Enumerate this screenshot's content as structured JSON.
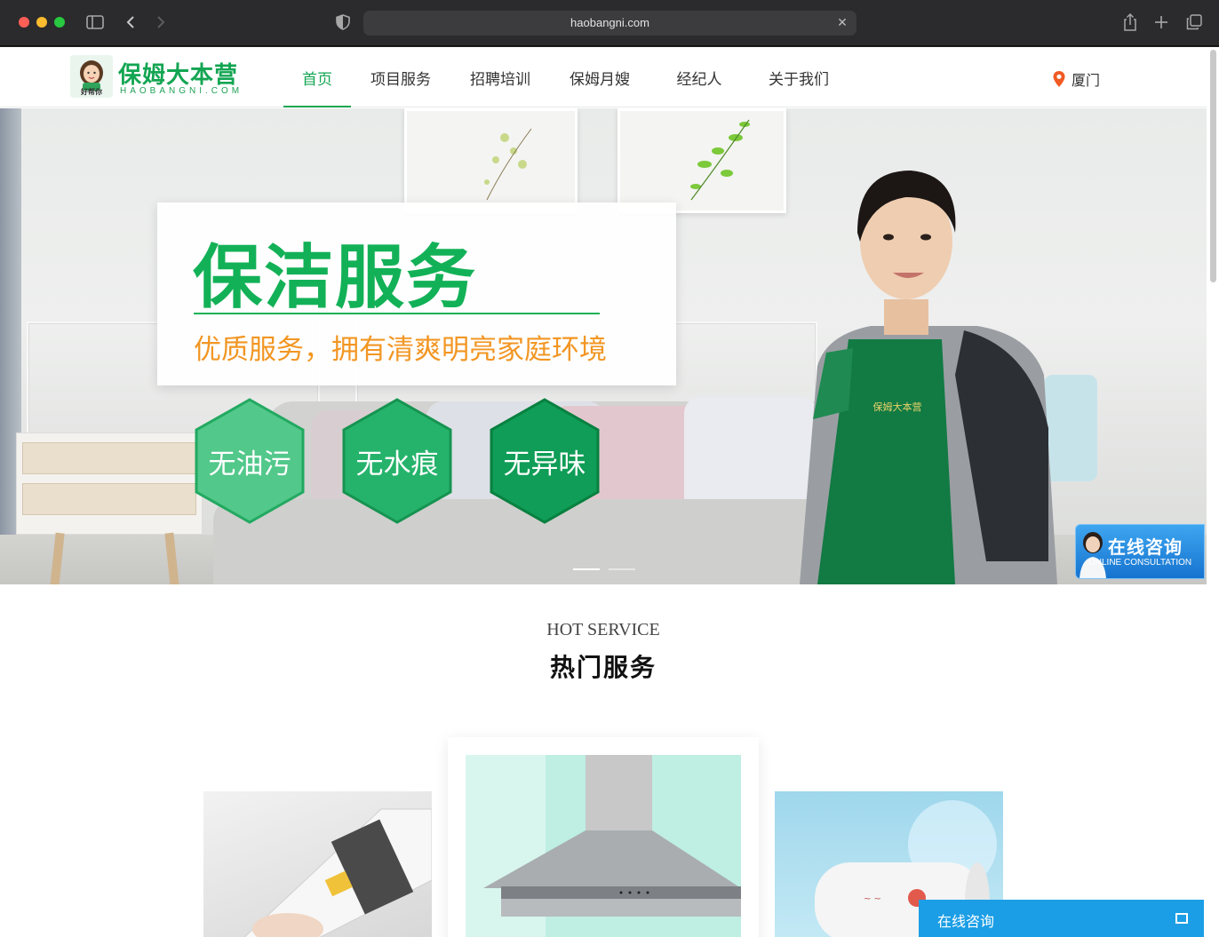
{
  "browser": {
    "url": "haobangni.com"
  },
  "site": {
    "logo_title": "保姆大本营",
    "logo_sub": "HAOBANGNI.COM",
    "logo_badge_text": "好帮你",
    "nav": [
      {
        "label": "首页",
        "active": true
      },
      {
        "label": "项目服务",
        "active": false
      },
      {
        "label": "招聘培训",
        "active": false
      },
      {
        "label": "保姆月嫂",
        "active": false
      },
      {
        "label": "经纪人",
        "active": false
      },
      {
        "label": "关于我们",
        "active": false
      }
    ],
    "city": "厦门"
  },
  "banner": {
    "title": "保洁服务",
    "subtitle": "优质服务，拥有清爽明亮家庭环境",
    "badges": [
      "无油污",
      "无水痕",
      "无异味"
    ],
    "apron_text": "保姆大本营",
    "slides": 2,
    "active_slide": 0
  },
  "consult_float": {
    "title": "在线咨询",
    "subtitle": "ONLINE CONSULTATION"
  },
  "hot_service": {
    "title_en": "HOT SERVICE",
    "title_cn": "热门服务"
  },
  "chat": {
    "label": "在线咨询"
  },
  "colors": {
    "brand_green": "#13a552",
    "accent_orange": "#f29623",
    "chat_blue": "#1b9ee6"
  }
}
